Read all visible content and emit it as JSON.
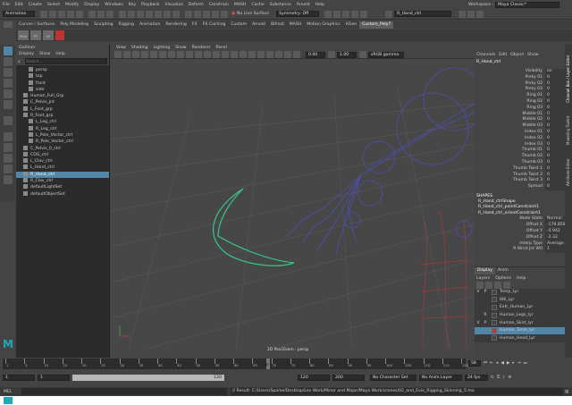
{
  "menubar": {
    "items": [
      "File",
      "Edit",
      "Create",
      "Select",
      "Modify",
      "Display",
      "Windows",
      "Key",
      "Playback",
      "Visualize",
      "Deform",
      "Constrain",
      "MASH",
      "Cache",
      "Substance",
      "Arnold",
      "Help"
    ],
    "workspace_label": "Workspace :",
    "workspace_value": "Maya Classic*"
  },
  "statusline": {
    "mode": "Animation",
    "no_live_surface": "No Live Surface",
    "symmetry": "Symmetry: Off",
    "selected_name": "R_Hand_ctrl"
  },
  "shelf": {
    "tabs": [
      "Curves / Surfaces",
      "Poly Modeling",
      "Sculpting",
      "Rigging",
      "Animation",
      "Rendering",
      "FX",
      "FX Caching",
      "Custom",
      "Arnold",
      "Bifrost",
      "MASH",
      "Motion Graphics",
      "XGen",
      "Custom_Poly7"
    ],
    "active_tab": "Custom_Poly7",
    "icon_labels": [
      "Blnd",
      "PT",
      "CP"
    ]
  },
  "outliner": {
    "title": "Outliner",
    "menu": [
      "Display",
      "Show",
      "Help"
    ],
    "search_placeholder": "Search...",
    "items": [
      {
        "label": "persp",
        "indent": 1,
        "selected": false
      },
      {
        "label": "top",
        "indent": 1,
        "selected": false
      },
      {
        "label": "front",
        "indent": 1,
        "selected": false
      },
      {
        "label": "side",
        "indent": 1,
        "selected": false
      },
      {
        "label": "Human_Full_Grp",
        "indent": 0,
        "selected": false
      },
      {
        "label": "C_Pelvis_jnt",
        "indent": 0,
        "selected": false
      },
      {
        "label": "L_Foot_grp",
        "indent": 0,
        "selected": false
      },
      {
        "label": "R_Foot_grp",
        "indent": 0,
        "selected": false
      },
      {
        "label": "L_Leg_ctrl",
        "indent": 1,
        "selected": false
      },
      {
        "label": "R_Leg_ctrl",
        "indent": 1,
        "selected": false
      },
      {
        "label": "L_Pole_Vector_ctrl",
        "indent": 1,
        "selected": false
      },
      {
        "label": "R_Pole_Vector_ctrl",
        "indent": 1,
        "selected": false
      },
      {
        "label": "C_Pelvis_0_ctrl",
        "indent": 0,
        "selected": false
      },
      {
        "label": "COG_ctrl",
        "indent": 0,
        "selected": false
      },
      {
        "label": "L_Clav_ctrl",
        "indent": 0,
        "selected": false
      },
      {
        "label": "L_Hand_ctrl",
        "indent": 0,
        "selected": false
      },
      {
        "label": "R_Hand_ctrl",
        "indent": 0,
        "selected": true
      },
      {
        "label": "R_Clav_ctrl",
        "indent": 0,
        "selected": false
      },
      {
        "label": "defaultLightSet",
        "indent": 0,
        "selected": false
      },
      {
        "label": "defaultObjectSet",
        "indent": 0,
        "selected": false
      }
    ]
  },
  "viewport": {
    "menu": [
      "View",
      "Shading",
      "Lighting",
      "Show",
      "Renderer",
      "Panel"
    ],
    "field1": "0.00",
    "field2": "1.00",
    "color_space": "sRGB gamma",
    "footer": "2D Pan/Zoom : persp"
  },
  "channelbox": {
    "menu": [
      "Channels",
      "Edit",
      "Object",
      "Show"
    ],
    "object_name": "R_Hand_ctrl",
    "channels": [
      {
        "name": "Visibility",
        "value": "on"
      },
      {
        "name": "Pinky 01",
        "value": "0"
      },
      {
        "name": "Pinky 02",
        "value": "0"
      },
      {
        "name": "Pinky 03",
        "value": "0"
      },
      {
        "name": "Ring 01",
        "value": "0"
      },
      {
        "name": "Ring 02",
        "value": "0"
      },
      {
        "name": "Ring 03",
        "value": "0"
      },
      {
        "name": "Middle 01",
        "value": "0"
      },
      {
        "name": "Middle 02",
        "value": "0"
      },
      {
        "name": "Middle 03",
        "value": "0"
      },
      {
        "name": "Index 01",
        "value": "0"
      },
      {
        "name": "Index 02",
        "value": "0"
      },
      {
        "name": "Index 03",
        "value": "0"
      },
      {
        "name": "Thumb 01",
        "value": "0"
      },
      {
        "name": "Thumb 02",
        "value": "0"
      },
      {
        "name": "Thumb 03",
        "value": "0"
      },
      {
        "name": "Thumb Twist 1",
        "value": "0"
      },
      {
        "name": "Thumb Twist 2",
        "value": "0"
      },
      {
        "name": "Thumb Twist 3",
        "value": "0"
      },
      {
        "name": "Spread",
        "value": "0"
      }
    ],
    "shapes_label": "SHAPES",
    "shapes": [
      "R_Hand_ctrlShape",
      "R_Hand_ctrl_pointConstraint1",
      "R_Hand_ctrl_orientConstraint1"
    ],
    "constraint_attrs": [
      {
        "name": "Node State",
        "value": "Normal"
      },
      {
        "name": "Offset X",
        "value": "-179.858"
      },
      {
        "name": "Offset Y",
        "value": "-5.942"
      },
      {
        "name": "Offset Z",
        "value": "-2.32"
      },
      {
        "name": "Interp Type",
        "value": "Average"
      },
      {
        "name": "R Wrist Jnt W0",
        "value": "1"
      }
    ]
  },
  "layer_editor": {
    "tabs": [
      "Display",
      "Anim"
    ],
    "menu": [
      "Layers",
      "Options",
      "Help"
    ],
    "layers": [
      {
        "v": "V",
        "p": "P",
        "name": "Temp_Lyr",
        "color": "#444444",
        "selected": false
      },
      {
        "v": "",
        "p": "",
        "name": "IKK_Lyr",
        "color": "#444444",
        "selected": false
      },
      {
        "v": "",
        "p": "",
        "name": "Extr_Human_Lyr",
        "color": "#444444",
        "selected": false
      },
      {
        "v": "",
        "p": "R",
        "name": "Human_Legs_lyr",
        "color": "#444444",
        "selected": false
      },
      {
        "v": "V",
        "p": "P",
        "name": "Human_Skirt_lyr",
        "color": "#444444",
        "selected": false
      },
      {
        "v": "",
        "p": "",
        "name": "Human_Torso_lyr",
        "color": "#d03030",
        "selected": true
      },
      {
        "v": "",
        "p": "",
        "name": "Human_Head_Lyr",
        "color": "#444444",
        "selected": false
      }
    ]
  },
  "timeslider": {
    "ticks": [
      "1",
      "5",
      "10",
      "15",
      "20",
      "25",
      "30",
      "35",
      "40",
      "45",
      "50",
      "55",
      "60",
      "65",
      "70",
      "75",
      "80",
      "85",
      "90",
      "95",
      "100",
      "105",
      "110",
      "115",
      "120"
    ],
    "current_frame": "58",
    "start_field": "1",
    "range_start": "1",
    "range_bar_label": "120",
    "range_end": "120",
    "end_field": "200",
    "char_set": "No Character Set",
    "anim_layer": "No Anim Layer",
    "fps": "24 fps"
  },
  "commandline": {
    "mode": "MEL",
    "result": "// Result: C:/Users/Sparke/Desktop/Lev Work/Minor and Major/Maya Work/scenes/02_and_Evie_Rigging_Skinning_5.ma"
  },
  "side_tabs": [
    "Channel Box / Layer Editor",
    "Modeling Toolkit",
    "Attribute Editor"
  ],
  "colors": {
    "accent": "#5285a6",
    "curve": "#34c987",
    "viewport_bg": "#474747"
  }
}
